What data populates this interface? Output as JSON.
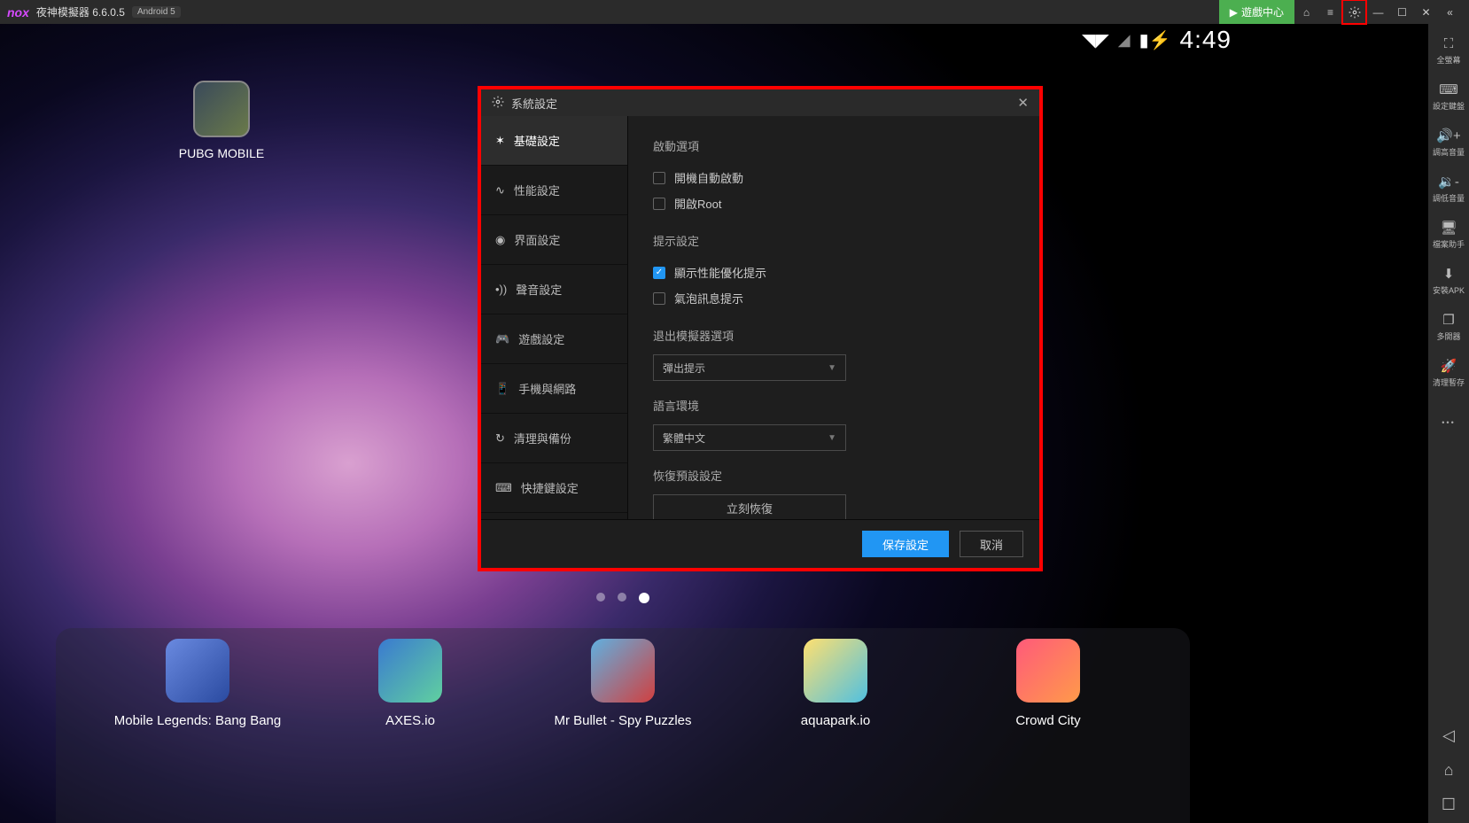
{
  "titlebar": {
    "logo": "nox",
    "app_name": "夜神模擬器 6.6.0.5",
    "android_badge": "Android 5",
    "game_center": "遊戲中心"
  },
  "android_status": {
    "time": "4:49"
  },
  "desktop": {
    "pubg_label": "PUBG MOBILE"
  },
  "dock": {
    "items": [
      {
        "label": "Mobile Legends: Bang Bang",
        "color1": "#6a8ae0",
        "color2": "#2a4aa0"
      },
      {
        "label": "AXES.io",
        "color1": "#3a7ad0",
        "color2": "#60d0a0"
      },
      {
        "label": "Mr Bullet - Spy Puzzles",
        "color1": "#60b0e0",
        "color2": "#d04040"
      },
      {
        "label": "aquapark.io",
        "color1": "#ffe070",
        "color2": "#50c0e0"
      },
      {
        "label": "Crowd City",
        "color1": "#ff5a7a",
        "color2": "#ff9a4a"
      }
    ]
  },
  "dialog": {
    "title": "系統設定",
    "tabs": [
      "基礎設定",
      "性能設定",
      "界面設定",
      "聲音設定",
      "遊戲設定",
      "手機與網路",
      "清理與備份",
      "快捷鍵設定"
    ],
    "sections": {
      "startup_title": "啟動選項",
      "startup_autostart": "開機自動啟動",
      "startup_root": "開啟Root",
      "hint_title": "提示設定",
      "hint_perf": "顯示性能優化提示",
      "hint_bubble": "氣泡訊息提示",
      "exit_title": "退出模擬器選項",
      "exit_value": "彈出提示",
      "lang_title": "語言環境",
      "lang_value": "繁體中文",
      "reset_title": "恢復預設設定",
      "reset_btn": "立刻恢復"
    },
    "footer": {
      "save": "保存設定",
      "cancel": "取消"
    }
  },
  "right_toolbar": {
    "items": [
      {
        "icon": "⛶",
        "label": "全螢幕"
      },
      {
        "icon": "⌨",
        "label": "設定鍵盤"
      },
      {
        "icon": "🔊+",
        "label": "調高音量"
      },
      {
        "icon": "🔉-",
        "label": "調低音量"
      },
      {
        "icon": "🖥",
        "label": "檔案助手"
      },
      {
        "icon": "⬇",
        "label": "安裝APK"
      },
      {
        "icon": "❐",
        "label": "多開器"
      },
      {
        "icon": "🚀",
        "label": "清理暫存"
      }
    ]
  }
}
